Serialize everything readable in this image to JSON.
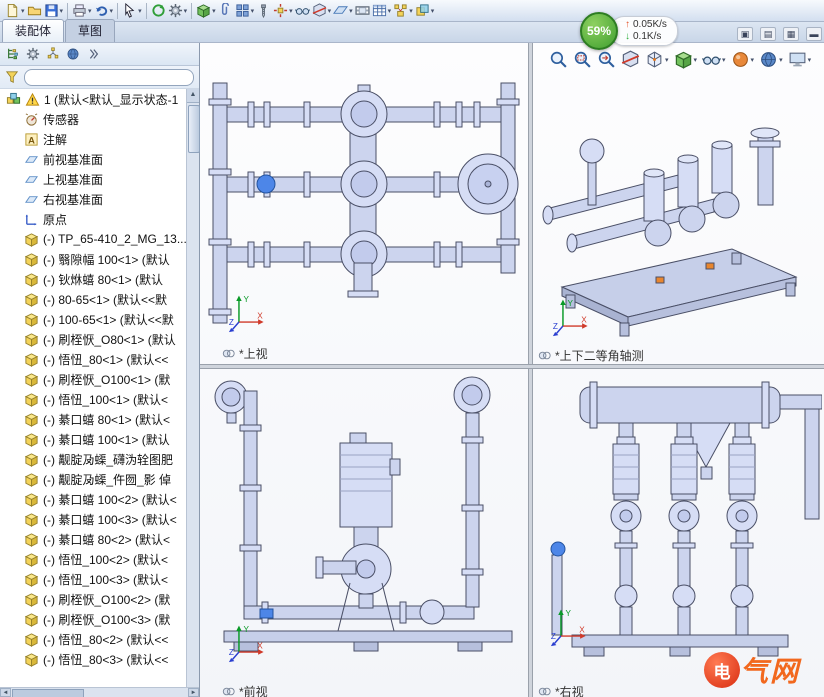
{
  "tabs": {
    "assembly": "装配体",
    "sketch": "草图"
  },
  "overlay": {
    "percent": "59%",
    "up_icon": "↑",
    "down_icon": "↓",
    "up_speed": "0.05K/s",
    "down_speed": "0.1K/s"
  },
  "tray": {
    "buttons": [
      "▣",
      "▤",
      "▦",
      "▬"
    ]
  },
  "toolbar_top": {
    "icons": [
      {
        "name": "new-document-icon",
        "glyph": "doc",
        "dd": true
      },
      {
        "name": "open-document-icon",
        "glyph": "folder"
      },
      {
        "name": "save-icon",
        "glyph": "disk",
        "dd": true
      },
      {
        "sep": true
      },
      {
        "name": "print-icon",
        "glyph": "printer",
        "dd": true
      },
      {
        "name": "undo-icon",
        "glyph": "undo",
        "dd": true
      },
      {
        "sep": true
      },
      {
        "name": "select-icon",
        "glyph": "cursor",
        "dd": true
      },
      {
        "sep": true
      },
      {
        "name": "rebuild-icon",
        "glyph": "rebuild"
      },
      {
        "name": "options-icon",
        "glyph": "gear",
        "dd": true
      },
      {
        "sep": true
      },
      {
        "name": "insert-component-icon",
        "glyph": "cube",
        "dd": true
      },
      {
        "name": "mate-icon",
        "glyph": "clip"
      },
      {
        "name": "component-pattern-icon",
        "glyph": "grid",
        "dd": true
      },
      {
        "name": "smart-fasteners-icon",
        "glyph": "screw"
      },
      {
        "name": "move-component-icon",
        "glyph": "cubemove",
        "dd": true
      },
      {
        "name": "show-hidden-components-icon",
        "glyph": "glasses"
      },
      {
        "name": "assembly-features-icon",
        "glyph": "cubecut",
        "dd": true
      },
      {
        "name": "reference-geometry-icon",
        "glyph": "plane",
        "dd": true
      },
      {
        "name": "motion-study-icon",
        "glyph": "film"
      },
      {
        "name": "bill-of-materials-icon",
        "glyph": "table",
        "dd": true
      },
      {
        "name": "exploded-view-icon",
        "glyph": "explode",
        "dd": true
      },
      {
        "name": "interference-detection-icon",
        "glyph": "cubes",
        "dd": true
      }
    ]
  },
  "view_toolbar": {
    "icons": [
      {
        "name": "zoom-to-fit-icon",
        "glyph": "mag"
      },
      {
        "name": "zoom-to-area-icon",
        "glyph": "magarea"
      },
      {
        "name": "previous-view-icon",
        "glyph": "magprev"
      },
      {
        "name": "section-view-icon",
        "glyph": "cubecut"
      },
      {
        "name": "view-orientation-icon",
        "glyph": "viewcube",
        "dd": true
      },
      {
        "name": "display-style-icon",
        "glyph": "cube",
        "dd": true
      },
      {
        "name": "hide-show-items-icon",
        "glyph": "glasses",
        "dd": true
      },
      {
        "name": "edit-appearance-icon",
        "glyph": "ballorange",
        "dd": true
      },
      {
        "name": "apply-scene-icon",
        "glyph": "ballblue",
        "dd": true
      },
      {
        "name": "view-settings-icon",
        "glyph": "monitor",
        "dd": true
      }
    ]
  },
  "panel_toolbar": {
    "icons": [
      {
        "name": "featuremanager-tree-icon",
        "glyph": "treeicon"
      },
      {
        "name": "propertymanager-icon",
        "glyph": "gear"
      },
      {
        "name": "configurationmanager-icon",
        "glyph": "config"
      },
      {
        "name": "displaymanager-icon",
        "glyph": "ballblue"
      },
      {
        "name": "panel-tabs-overflow-icon",
        "glyph": "chev"
      }
    ]
  },
  "tree": {
    "root_label": "1 (默认<默认_显示状态-1",
    "items": [
      {
        "icon": "sensor",
        "label": "传感器"
      },
      {
        "icon": "annotation",
        "label": "注解"
      },
      {
        "icon": "plane",
        "label": "前视基准面"
      },
      {
        "icon": "plane",
        "label": "上视基准面"
      },
      {
        "icon": "plane",
        "label": "右视基准面"
      },
      {
        "icon": "origin",
        "label": "原点"
      },
      {
        "icon": "part",
        "label": "(-) TP_65-410_2_MG_13..."
      },
      {
        "icon": "part",
        "label": "(-) 翳隙幅 100<1> (默认"
      },
      {
        "icon": "part",
        "label": "(-) 钬烌蟢 80<1> (默认"
      },
      {
        "icon": "part",
        "label": "(-) 80-65<1> (默认<<默"
      },
      {
        "icon": "part",
        "label": "(-) 100-65<1> (默认<<默"
      },
      {
        "icon": "part",
        "label": "(-) 刷桎恹_O80<1> (默认"
      },
      {
        "icon": "part",
        "label": "(-) 悟忸_80<1> (默认<<"
      },
      {
        "icon": "part",
        "label": "(-) 刷桎恹_O100<1> (默"
      },
      {
        "icon": "part",
        "label": "(-) 悟忸_100<1> (默认<"
      },
      {
        "icon": "part",
        "label": "(-) 綦口蟢 80<1> (默认<"
      },
      {
        "icon": "part",
        "label": "(-) 綦口蟢 100<1> (默认"
      },
      {
        "icon": "part",
        "label": "(-) 觏腚夃蟝_礴沩辁图肥"
      },
      {
        "icon": "part",
        "label": "(-) 觏腚夃蟝_仵囫_影 倬"
      },
      {
        "icon": "part",
        "label": "(-) 綦口蟢 100<2> (默认<"
      },
      {
        "icon": "part",
        "label": "(-) 綦口蟢 100<3> (默认<"
      },
      {
        "icon": "part",
        "label": "(-) 綦口蟢 80<2> (默认<"
      },
      {
        "icon": "part",
        "label": "(-) 悟忸_100<2> (默认<"
      },
      {
        "icon": "part",
        "label": "(-) 悟忸_100<3> (默认<"
      },
      {
        "icon": "part",
        "label": "(-) 刷桎恹_O100<2> (默"
      },
      {
        "icon": "part",
        "label": "(-) 刷桎恹_O100<3> (默"
      },
      {
        "icon": "part",
        "label": "(-) 悟忸_80<2> (默认<<"
      },
      {
        "icon": "part",
        "label": "(-) 悟忸_80<3> (默认<<"
      }
    ]
  },
  "viewports": [
    {
      "label": "*上视"
    },
    {
      "label": "*上下二等角轴测"
    },
    {
      "label": "*前视"
    },
    {
      "label": "*右视"
    }
  ],
  "triad": {
    "x": "X",
    "y": "Y",
    "z": "Z"
  },
  "watermark": {
    "logo_char": "电",
    "logo_text": "气网"
  },
  "colors": {
    "badge_green": "#3f9f2f",
    "up_arrow": "#e5542a",
    "down_arrow": "#2faf3c",
    "model_fill": "#ccd4ee",
    "selection_blue": "#4d86e8",
    "toolbar_bg": "#d3dff0"
  }
}
